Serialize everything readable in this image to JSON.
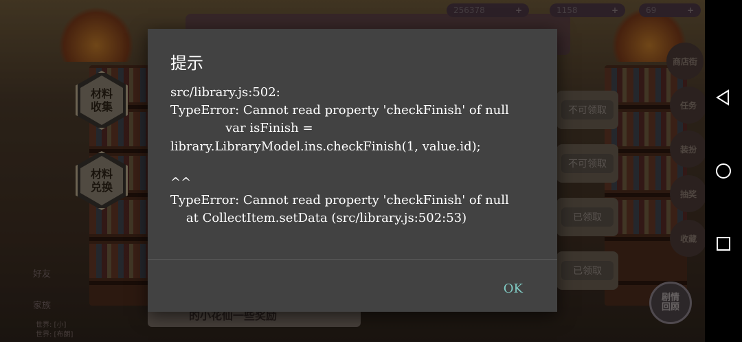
{
  "game": {
    "currencies": [
      {
        "value": "256378",
        "plus": "+"
      },
      {
        "value": "1158",
        "plus": "+"
      },
      {
        "value": "69",
        "plus": "+"
      }
    ],
    "left_buttons": [
      {
        "label": "材料\n收集"
      },
      {
        "label": "材料\n兑换"
      }
    ],
    "right_buttons": [
      {
        "label": "商店街"
      },
      {
        "label": "任务"
      },
      {
        "label": "装扮"
      },
      {
        "label": "抽奖"
      },
      {
        "label": "收藏"
      }
    ],
    "reward_buttons": [
      {
        "label": "不可领取"
      },
      {
        "label": "不可领取"
      },
      {
        "label": "已领取"
      },
      {
        "label": "已领取"
      }
    ],
    "bottom_banner_text": "的小花仙一些奖励",
    "friend_labels": [
      "好友",
      "家族"
    ],
    "chat_lines": [
      "世界: [小]",
      "世界: [布朗]"
    ],
    "story_button_label": "剧情\n回顾"
  },
  "dialog": {
    "title": "提示",
    "message": "src/library.js:502:\nTypeError: Cannot read property 'checkFinish' of null\n              var isFinish =\nlibrary.LibraryModel.ins.checkFinish(1, value.id);\n\n^^\nTypeError: Cannot read property 'checkFinish' of null\n    at CollectItem.setData (src/library.js:502:53)",
    "ok_label": "OK"
  },
  "navbar": {
    "back_icon": "triangle-back-icon",
    "home_icon": "circle-home-icon",
    "recent_icon": "square-recent-icon"
  }
}
